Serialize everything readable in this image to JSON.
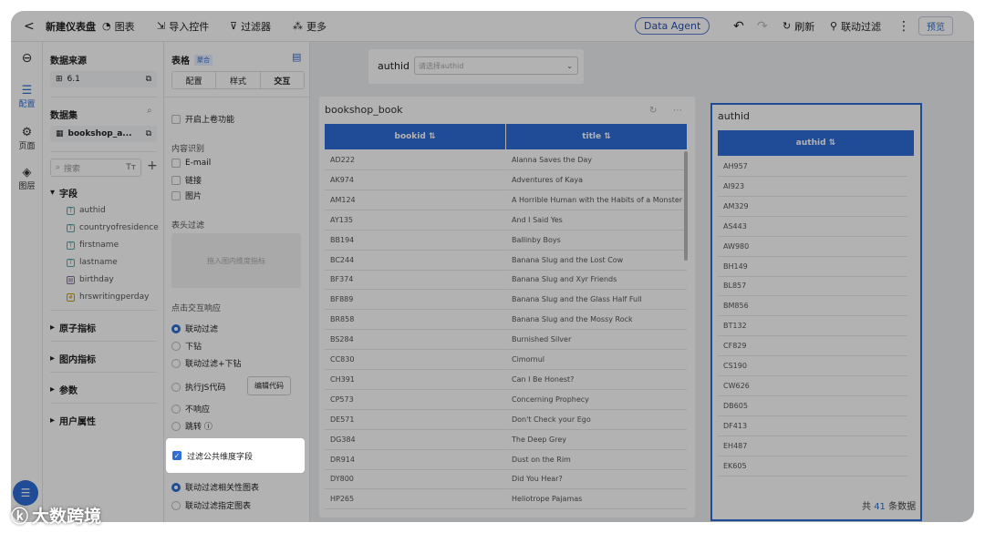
{
  "topbar": {
    "back": "<",
    "title": "新建仪表盘",
    "chart": "图表",
    "import": "导入控件",
    "filter": "过滤器",
    "more": "更多",
    "agent": "Data Agent",
    "refresh": "刷新",
    "linkage": "联动过滤",
    "preview": "预览"
  },
  "rail": {
    "nav1": "配置",
    "nav2": "页面",
    "nav3": "图层"
  },
  "datasource": {
    "title": "数据来源",
    "value": "6.1",
    "dataset_title": "数据集",
    "dataset_value": "bookshop_a...",
    "search_placeholder": "搜索",
    "fields_title": "字段",
    "fields": [
      "authid",
      "countryofresidence",
      "firstname",
      "lastname",
      "birthday",
      "hrswritingperday"
    ],
    "groups": [
      "原子指标",
      "图内指标",
      "参数",
      "用户属性"
    ]
  },
  "props": {
    "title": "表格",
    "badge": "聚合",
    "tabs": [
      "配置",
      "样式",
      "交互"
    ],
    "scroll_load": "开启上卷功能",
    "content_title": "内容识别",
    "content_opts": [
      "E-mail",
      "链接",
      "图片"
    ],
    "header_filter": "表头过滤",
    "drop_hint": "拖入图内维度指标",
    "click_title": "点击交互响应",
    "click_opts": [
      "联动过滤",
      "下钻",
      "联动过滤+下钻",
      "执行JS代码",
      "不响应",
      "跳转 ⓘ"
    ],
    "edit_code": "编辑代码",
    "public_dim": "过滤公共维度字段",
    "linkage_opts": [
      "联动过滤相关性图表",
      "联动过滤指定图表"
    ]
  },
  "filter_ctrl": {
    "label": "authid",
    "placeholder": "请选择authid"
  },
  "table1": {
    "title": "bookshop_book",
    "col1": "bookid ⇅",
    "col2": "title ⇅",
    "rows": [
      [
        "AD222",
        "Alanna Saves the Day"
      ],
      [
        "AK974",
        "Adventures of Kaya"
      ],
      [
        "AM124",
        "A Horrible Human with the Habits of a Monster"
      ],
      [
        "AY135",
        "And I Said Yes"
      ],
      [
        "BB194",
        "Ballinby Boys"
      ],
      [
        "BC244",
        "Banana Slug and the Lost Cow"
      ],
      [
        "BF374",
        "Banana Slug and Xyr Friends"
      ],
      [
        "BF889",
        "Banana Slug and the Glass Half Full"
      ],
      [
        "BR858",
        "Banana Slug and the Mossy Rock"
      ],
      [
        "BS284",
        "Burnished Silver"
      ],
      [
        "CC830",
        "Cimornul"
      ],
      [
        "CH391",
        "Can I Be Honest?"
      ],
      [
        "CP573",
        "Concerning Prophecy"
      ],
      [
        "DE571",
        "Don't Check your Ego"
      ],
      [
        "DG384",
        "The Deep Grey"
      ],
      [
        "DR914",
        "Dust on the Rim"
      ],
      [
        "DY800",
        "Did You Hear?"
      ],
      [
        "HP265",
        "Heliotrope Pajamas"
      ]
    ]
  },
  "table2": {
    "title": "authid",
    "col1": "authid ⇅",
    "rows": [
      "AH957",
      "AI923",
      "AM329",
      "AS443",
      "AW980",
      "BH149",
      "BL857",
      "BM856",
      "BT132",
      "CF829",
      "CS190",
      "CW626",
      "DB605",
      "DF413",
      "EH487",
      "EK605"
    ],
    "footer_pre": "共",
    "footer_count": "41",
    "footer_post": "条数据"
  },
  "watermark": "大数跨境"
}
